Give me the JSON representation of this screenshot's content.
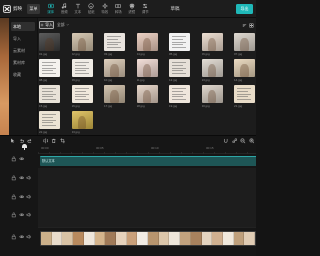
{
  "app": {
    "name": "剪映",
    "menu_label": "菜单",
    "title": "草稿",
    "export_label": "导出"
  },
  "toolbar": [
    {
      "label": "媒体",
      "icon": "media-icon",
      "active": true
    },
    {
      "label": "音频",
      "icon": "audio-icon"
    },
    {
      "label": "文本",
      "icon": "text-icon"
    },
    {
      "label": "贴纸",
      "icon": "sticker-icon"
    },
    {
      "label": "特效",
      "icon": "effects-icon"
    },
    {
      "label": "转场",
      "icon": "transition-icon"
    },
    {
      "label": "滤镜",
      "icon": "filter-icon"
    },
    {
      "label": "调节",
      "icon": "adjust-icon"
    }
  ],
  "sidebar": {
    "items": [
      {
        "label": "本地",
        "active": true
      },
      {
        "label": "导入"
      },
      {
        "label": "云素材"
      },
      {
        "label": "素材库"
      },
      {
        "label": "收藏"
      }
    ]
  },
  "media": {
    "import_label": "导入",
    "filter_label": "全部",
    "view_icons": [
      "sort-icon",
      "grid-view-icon"
    ],
    "items": [
      {
        "name": "01.jpg",
        "color": "#3a3a3a"
      },
      {
        "name": "02.jpg",
        "color": "#cdbda4"
      },
      {
        "name": "03.jpg",
        "color": "#e9e4de",
        "doc": true
      },
      {
        "name": "04.jpg",
        "color": "#e8c8b8"
      },
      {
        "name": "05.jpg",
        "color": "#f2f2f2",
        "doc": true
      },
      {
        "name": "06.jpg",
        "color": "#e9d8c9"
      },
      {
        "name": "07.jpg",
        "color": "#d9d2c8"
      },
      {
        "name": "08.jpg",
        "color": "#f4f2ee",
        "doc": true
      },
      {
        "name": "09.jpg",
        "color": "#efebe4",
        "doc": true
      },
      {
        "name": "10.jpg",
        "color": "#d6c4ae"
      },
      {
        "name": "11.jpg",
        "color": "#f0d8d0"
      },
      {
        "name": "12.jpg",
        "color": "#e6e0d8",
        "doc": true
      },
      {
        "name": "13.jpg",
        "color": "#ddd6cc"
      },
      {
        "name": "14.jpg",
        "color": "#e6d3b5"
      },
      {
        "name": "15.jpg",
        "color": "#e8e2d8",
        "doc": true
      },
      {
        "name": "16.jpg",
        "color": "#f0e8dc",
        "doc": true
      },
      {
        "name": "17.jpg",
        "color": "#c9b8a0"
      },
      {
        "name": "18.jpg",
        "color": "#e2cfc0"
      },
      {
        "name": "19.jpg",
        "color": "#efe6dc",
        "doc": true
      },
      {
        "name": "20.jpg",
        "color": "#d8cec2"
      },
      {
        "name": "21.jpg",
        "color": "#e8dcc8",
        "doc": true
      },
      {
        "name": "22.jpg",
        "color": "#ece4d4",
        "doc": true
      },
      {
        "name": "23.jpg",
        "color": "#d9b84a"
      }
    ]
  },
  "timeline": {
    "tools": [
      "cursor-icon",
      "undo-icon",
      "redo-icon",
      "split-icon",
      "delete-icon",
      "crop-icon"
    ],
    "right_tools": [
      "magnet-icon",
      "link-icon",
      "zoom-out-icon",
      "zoom-in-icon"
    ],
    "ruler_labels": [
      "00:00",
      "00:05",
      "00:10",
      "00:15"
    ],
    "text_clip": {
      "label": "默认文本"
    },
    "track_headers": [
      [
        "lock-icon",
        "eye-icon"
      ],
      [
        "lock-icon",
        "eye-icon",
        "speaker-icon"
      ],
      [
        "lock-icon",
        "eye-icon",
        "speaker-icon"
      ],
      [
        "lock-icon",
        "eye-icon",
        "speaker-icon"
      ],
      [
        "lock-icon",
        "eye-icon",
        "speaker-icon"
      ]
    ],
    "main_clip_frames": [
      "#cbb08a",
      "#e8dccb",
      "#d9c3a5",
      "#b88a5e",
      "#efe7dc",
      "#d4b48c",
      "#a07a58",
      "#e6d2bc",
      "#c9a07a",
      "#f2ece4",
      "#b8956e",
      "#dcc6aa",
      "#eee6da",
      "#c2a27e",
      "#a8825e",
      "#e4d4c0",
      "#d0b090",
      "#f0e8dc",
      "#bfa07c",
      "#e0ccb4"
    ]
  },
  "colors": {
    "accent": "#1fb8b8",
    "text_clip": "#1e5656"
  }
}
